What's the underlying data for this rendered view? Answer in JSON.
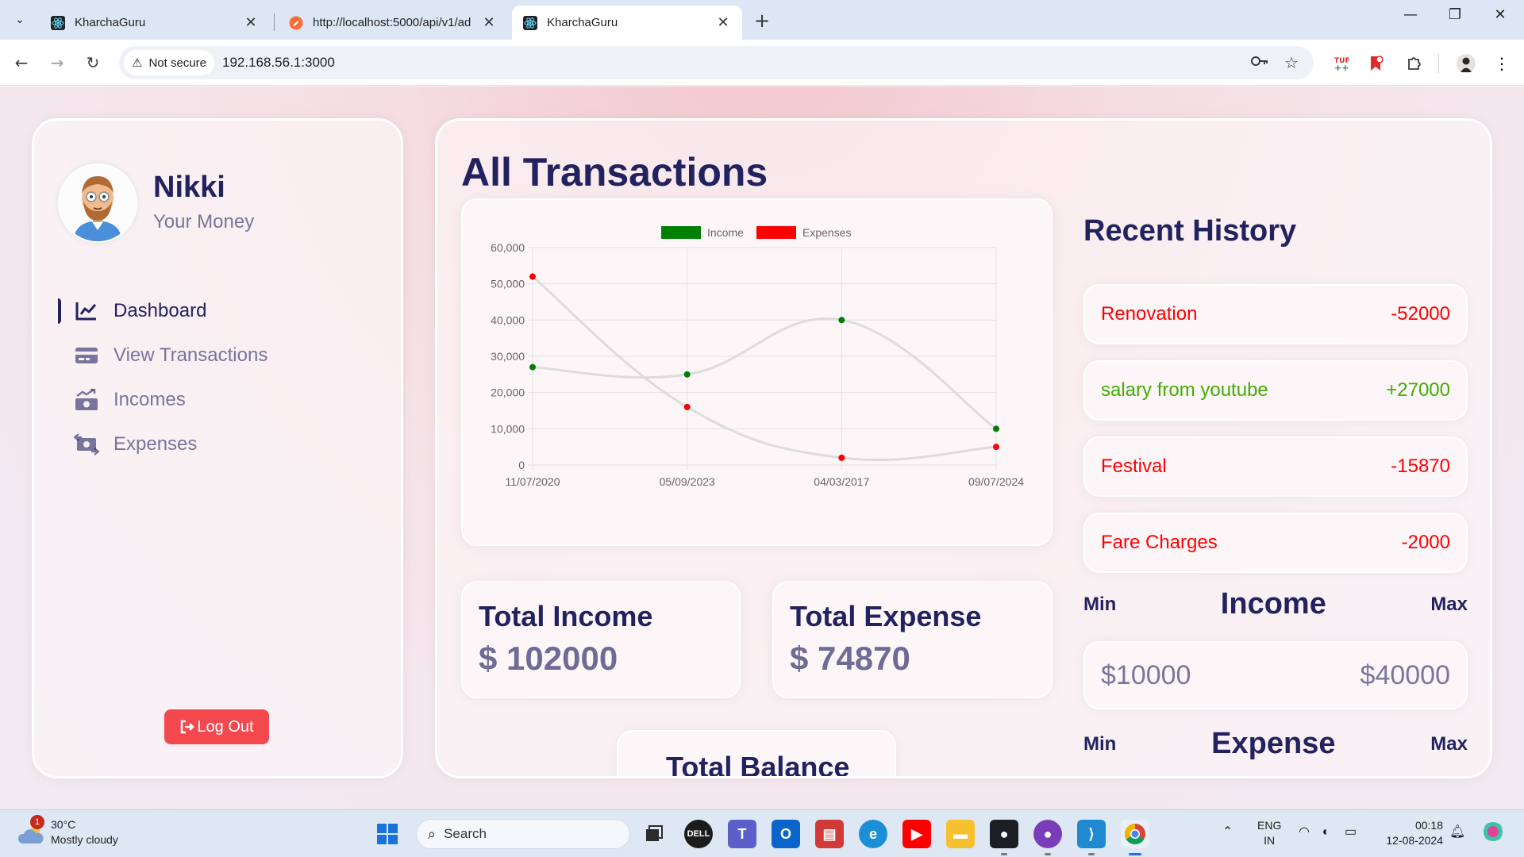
{
  "browser": {
    "tabs": [
      {
        "title": "KharchaGuru",
        "active": false
      },
      {
        "title": "http://localhost:5000/api/v1/ad",
        "active": false
      },
      {
        "title": "KharchaGuru",
        "active": true
      }
    ],
    "security_label": "Not secure",
    "url": "192.168.56.1:3000"
  },
  "user": {
    "name": "Nikki",
    "subtitle": "Your Money"
  },
  "menu": [
    {
      "label": "Dashboard",
      "icon": "chart-line-icon",
      "active": true
    },
    {
      "label": "View Transactions",
      "icon": "credit-card-icon",
      "active": false
    },
    {
      "label": "Incomes",
      "icon": "money-bill-trend-up-icon",
      "active": false
    },
    {
      "label": "Expenses",
      "icon": "money-bill-transfer-icon",
      "active": false
    }
  ],
  "logout_label": "Log Out",
  "main": {
    "title": "All Transactions",
    "total_income": {
      "title": "Total Income",
      "value": "$ 102000"
    },
    "total_expense": {
      "title": "Total Expense",
      "value": "$ 74870"
    },
    "total_balance": {
      "title": "Total Balance"
    }
  },
  "chart_data": {
    "type": "line",
    "x": [
      "11/07/2020",
      "05/09/2023",
      "04/03/2017",
      "09/07/2024"
    ],
    "series": [
      {
        "name": "Income",
        "color": "#008000",
        "values": [
          27000,
          25000,
          40000,
          10000
        ]
      },
      {
        "name": "Expenses",
        "color": "#ff0000",
        "values": [
          52000,
          16000,
          2000,
          5000
        ]
      }
    ],
    "ylim": [
      0,
      60000
    ],
    "yticks": [
      "60,000",
      "50,000",
      "40,000",
      "30,000",
      "20,000",
      "10,000",
      "0"
    ],
    "legend_position": "top",
    "grid": true,
    "line_color": "#dcdcdc"
  },
  "history": {
    "title": "Recent History",
    "items": [
      {
        "label": "Renovation",
        "amount": "-52000",
        "kind": "expense"
      },
      {
        "label": "salary from youtube",
        "amount": "+27000",
        "kind": "income"
      },
      {
        "label": "Festival",
        "amount": "-15870",
        "kind": "expense"
      },
      {
        "label": "Fare Charges",
        "amount": "-2000",
        "kind": "expense"
      }
    ],
    "income_range": {
      "min_label": "Min",
      "title": "Income",
      "max_label": "Max",
      "min_value": "$10000",
      "max_value": "$40000"
    },
    "expense_range": {
      "min_label": "Min",
      "title": "Expense",
      "max_label": "Max"
    }
  },
  "taskbar": {
    "weather_temp": "30°C",
    "weather_desc": "Mostly cloudy",
    "weather_badge": "1",
    "search_label": "Search",
    "lang_top": "ENG",
    "lang_bottom": "IN",
    "time": "00:18",
    "date": "12-08-2024"
  }
}
